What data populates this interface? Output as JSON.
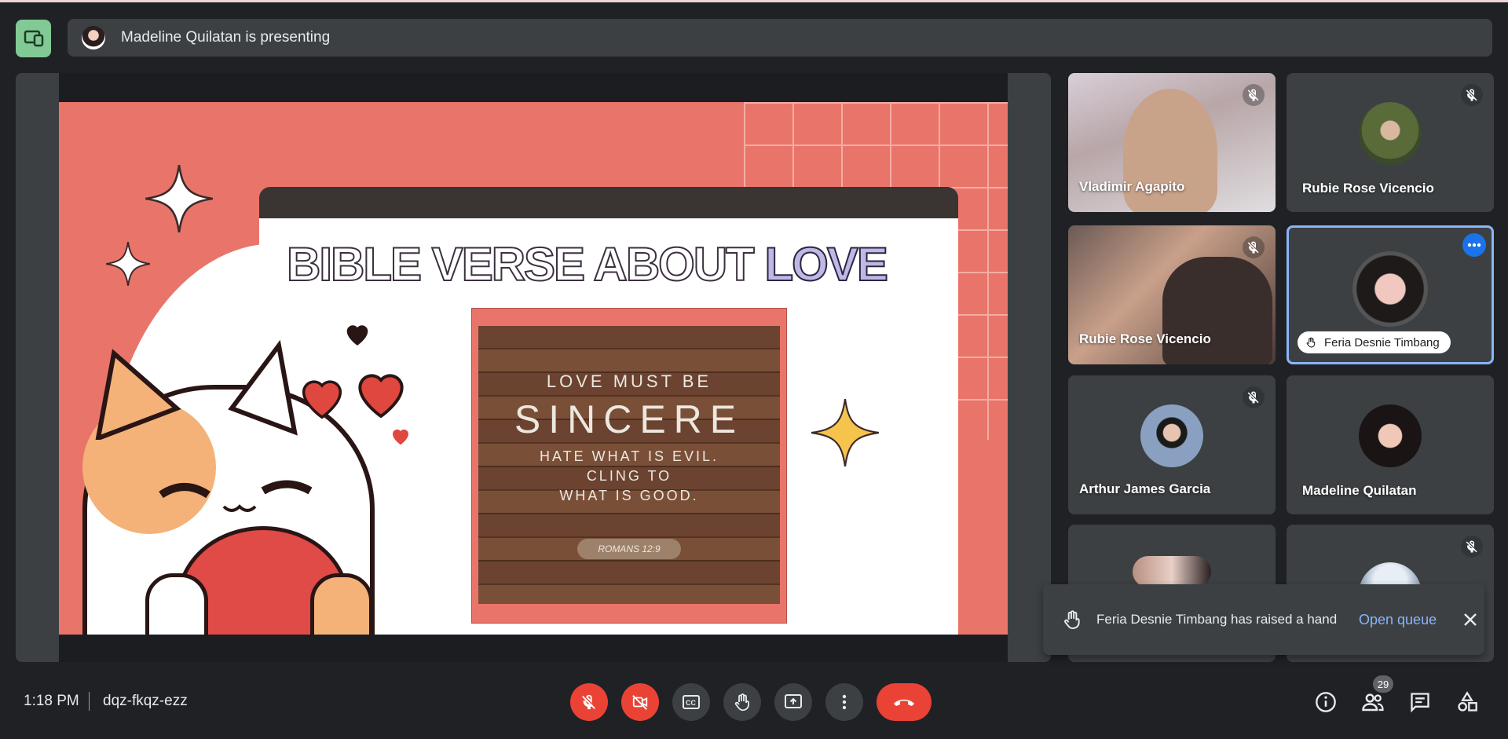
{
  "header": {
    "presenting_text": "Madeline Quilatan is presenting"
  },
  "slide": {
    "title_part1": "BIBLE VERSE ABOUT",
    "title_part2": "LOVE",
    "verse_line1": "LOVE MUST BE",
    "verse_line2": "SINCERE",
    "verse_line3": "HATE WHAT IS EVIL.",
    "verse_line4": "CLING TO",
    "verse_line5": "WHAT IS GOOD.",
    "verse_reference": "ROMANS 12:9"
  },
  "participants": [
    {
      "name": "Vladimir Agapito",
      "muted": true
    },
    {
      "name": "Rubie Rose Vicencio",
      "muted": true
    },
    {
      "name": "Rubie Rose Vicencio",
      "muted": true
    },
    {
      "name": "Feria Desnie Timbang",
      "muted": false,
      "hand_raised": true
    },
    {
      "name": "Arthur James Garcia",
      "muted": true
    },
    {
      "name": "Madeline Quilatan",
      "muted": false
    }
  ],
  "notification": {
    "message": "Feria Desnie Timbang has raised a hand",
    "action": "Open queue"
  },
  "footer": {
    "time": "1:18 PM",
    "meeting_code": "dqz-fkqz-ezz",
    "participant_count": "29"
  },
  "colors": {
    "background": "#202124",
    "tile": "#3c4043",
    "danger": "#ea4335",
    "accent": "#8ab4f8",
    "present_green": "#81c995"
  },
  "icons": [
    "present-to-all-icon",
    "mic-off-icon",
    "videocam-off-icon",
    "closed-caption-icon",
    "raise-hand-icon",
    "present-screen-icon",
    "more-vert-icon",
    "call-end-icon",
    "info-icon",
    "people-icon",
    "chat-icon",
    "activities-icon",
    "close-icon"
  ]
}
